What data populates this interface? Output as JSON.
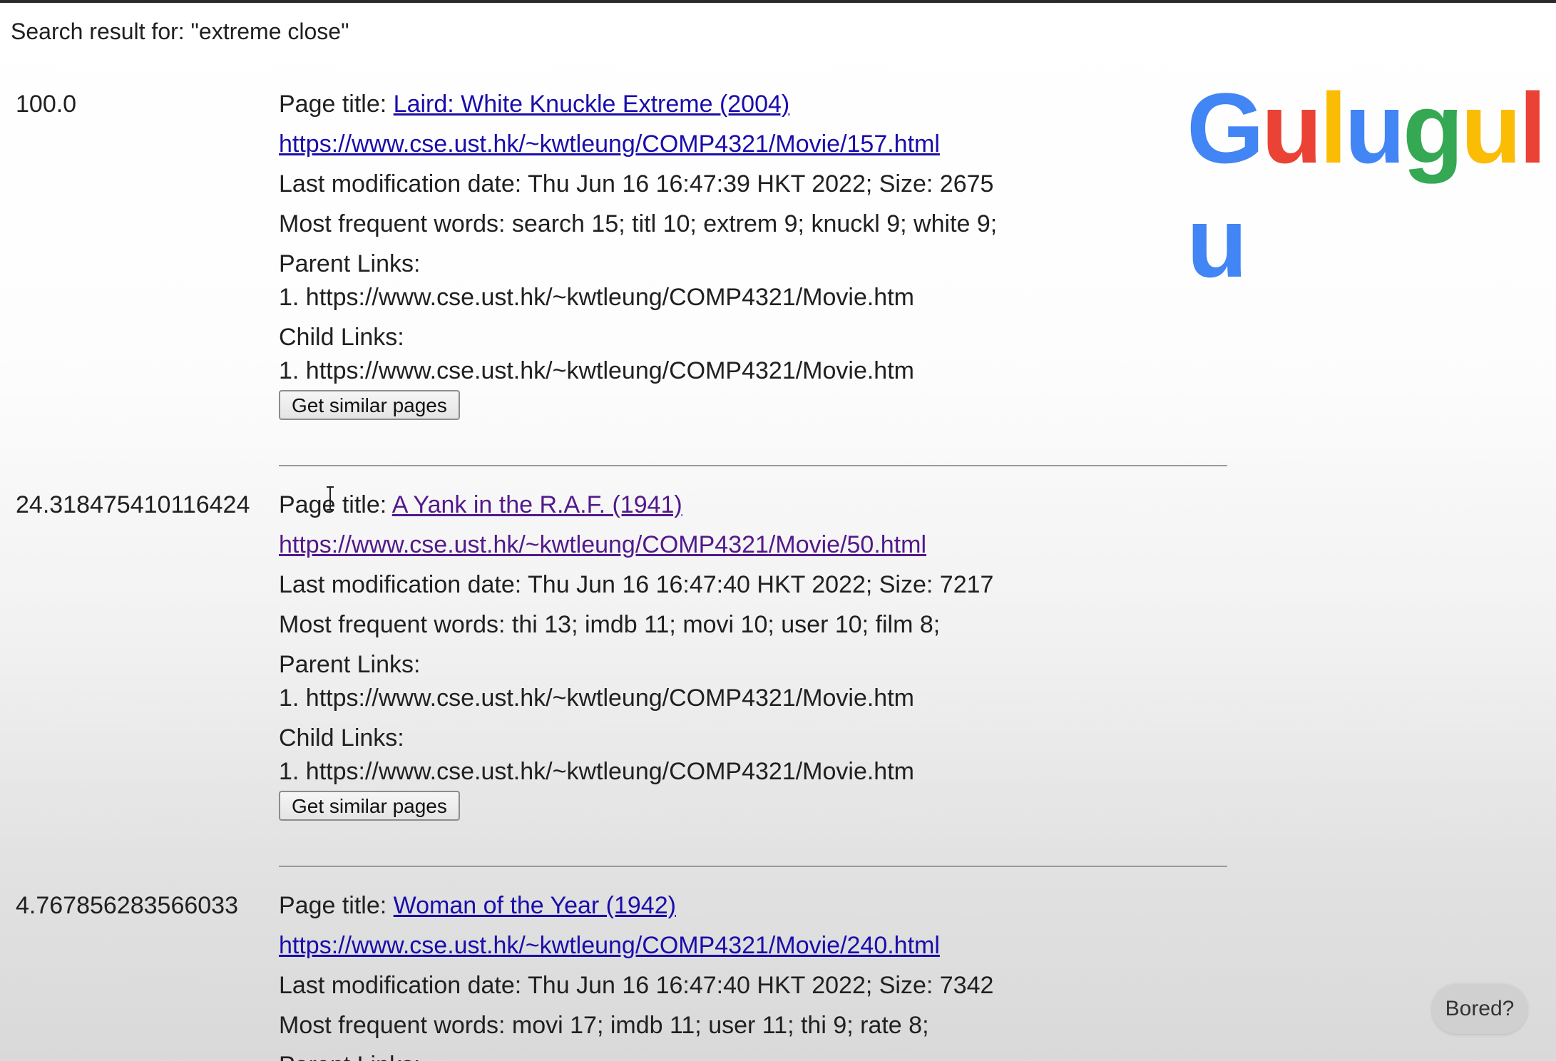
{
  "search": {
    "header": "Search result for: \"extreme close\""
  },
  "logo": {
    "letters": [
      {
        "char": "G",
        "color": "#4285F4"
      },
      {
        "char": "u",
        "color": "#EA4335"
      },
      {
        "char": "l",
        "color": "#FBBC05"
      },
      {
        "char": "u",
        "color": "#4285F4"
      },
      {
        "char": "g",
        "color": "#34A853"
      },
      {
        "char": "u",
        "color": "#FBBC05"
      },
      {
        "char": "l",
        "color": "#EA4335"
      },
      {
        "char": "u",
        "color": "#4285F4"
      }
    ]
  },
  "results": [
    {
      "score": "100.0",
      "title_prefix": "Page title: ",
      "title": "Laird: White Knuckle Extreme (2004)",
      "url": "https://www.cse.ust.hk/~kwtleung/COMP4321/Movie/157.html",
      "modified": "Last modification date: Thu Jun 16 16:47:39 HKT 2022; Size: 2675",
      "words": "Most frequent words: search 15; titl 10; extrem 9; knuckl 9; white 9;",
      "parent_label": "Parent Links:",
      "parent_links": [
        "1. https://www.cse.ust.hk/~kwtleung/COMP4321/Movie.htm"
      ],
      "child_label": "Child Links:",
      "child_links": [
        "1. https://www.cse.ust.hk/~kwtleung/COMP4321/Movie.htm"
      ],
      "button": "Get similar pages"
    },
    {
      "score": "24.318475410116424",
      "title_prefix": "Page title: ",
      "title": "A Yank in the R.A.F. (1941)",
      "url": "https://www.cse.ust.hk/~kwtleung/COMP4321/Movie/50.html",
      "modified": "Last modification date: Thu Jun 16 16:47:40 HKT 2022; Size: 7217",
      "words": "Most frequent words: thi 13; imdb 11; movi 10; user 10; film 8;",
      "parent_label": "Parent Links:",
      "parent_links": [
        "1. https://www.cse.ust.hk/~kwtleung/COMP4321/Movie.htm"
      ],
      "child_label": "Child Links:",
      "child_links": [
        "1. https://www.cse.ust.hk/~kwtleung/COMP4321/Movie.htm"
      ],
      "button": "Get similar pages"
    },
    {
      "score": "4.767856283566033",
      "title_prefix": "Page title: ",
      "title": "Woman of the Year (1942)",
      "url": "https://www.cse.ust.hk/~kwtleung/COMP4321/Movie/240.html",
      "modified": "Last modification date: Thu Jun 16 16:47:40 HKT 2022; Size: 7342",
      "words": "Most frequent words: movi 17; imdb 11; user 11; thi 9; rate 8;",
      "parent_label": "Parent Links:"
    }
  ],
  "floating": {
    "bored_label": "Bored?"
  }
}
